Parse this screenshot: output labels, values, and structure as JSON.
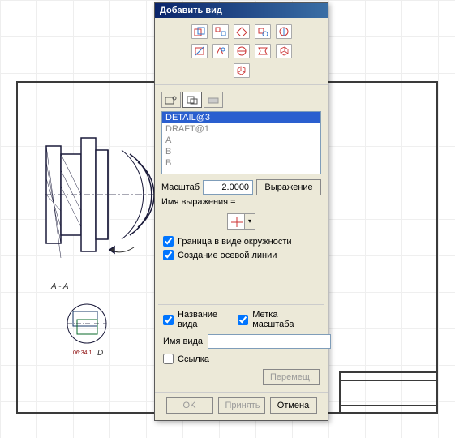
{
  "dialog": {
    "title": "Добавить вид",
    "list": {
      "items": [
        "DETAIL@3",
        "DRAFT@1",
        "A",
        "B",
        "B"
      ],
      "selected_index": 0
    },
    "scale": {
      "label": "Масштаб",
      "value": "2.0000",
      "expr_button": "Выражение",
      "expr_name_label": "Имя выражения ="
    },
    "options": {
      "boundary_circle": "Граница в виде окружности",
      "create_centerline": "Создание осевой линии",
      "view_label": "Название вида",
      "scale_label": "Метка масштаба"
    },
    "view_name_label": "Имя вида",
    "view_name_value": "",
    "link_label": "Ссылка",
    "move_button": "Перемещ.",
    "buttons": {
      "ok": "OK",
      "apply": "Принять",
      "cancel": "Отмена"
    }
  },
  "canvas": {
    "section_label": "A - A",
    "detail_label": "D",
    "scale_note": "06:34:1"
  }
}
